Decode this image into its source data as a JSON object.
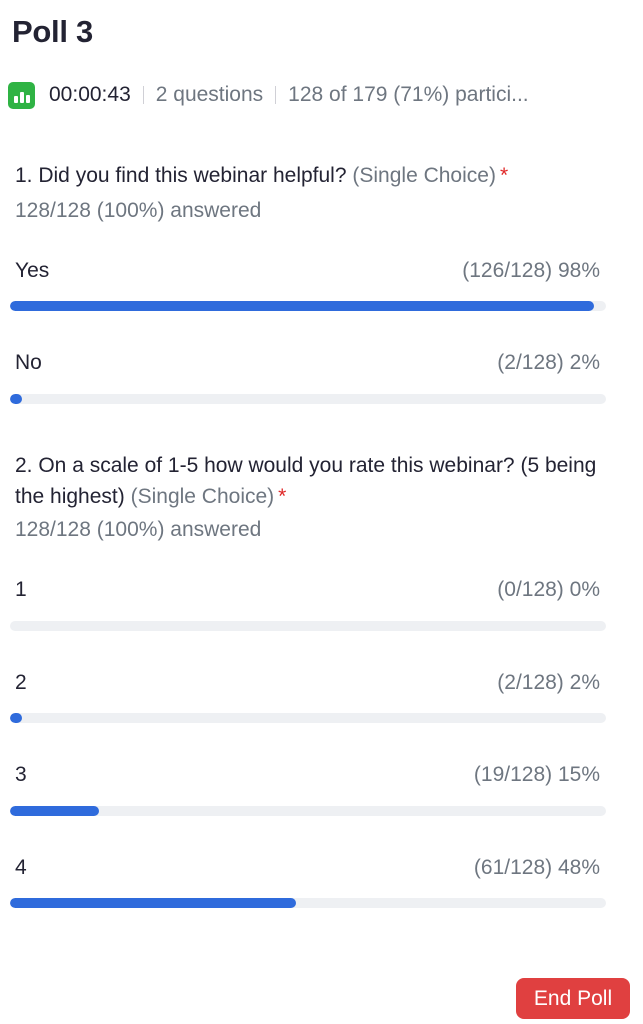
{
  "poll": {
    "title": "Poll 3",
    "timer": "00:00:43",
    "question_count": "2 questions",
    "participants": "128 of 179 (71%) partici..."
  },
  "icons": {
    "poll": "bar-chart-icon"
  },
  "colors": {
    "accent": "#2f6bdc",
    "danger": "#e04040",
    "poll_icon": "#2fb344",
    "required": "#e02828"
  },
  "questions": [
    {
      "text": "1. Did you find this webinar helpful?",
      "type": "(Single Choice)",
      "required": "*",
      "answered": "128/128 (100%) answered",
      "options": [
        {
          "label": "Yes",
          "stat": "(126/128) 98%",
          "percent": 98
        },
        {
          "label": "No",
          "stat": "(2/128) 2%",
          "percent": 2
        }
      ]
    },
    {
      "text": "2. On a scale of 1-5 how would you rate this webinar? (5 being the highest)",
      "type": "(Single Choice)",
      "required": "*",
      "answered": "128/128 (100%) answered",
      "options": [
        {
          "label": "1",
          "stat": "(0/128) 0%",
          "percent": 0
        },
        {
          "label": "2",
          "stat": "(2/128) 2%",
          "percent": 2
        },
        {
          "label": "3",
          "stat": "(19/128) 15%",
          "percent": 15
        },
        {
          "label": "4",
          "stat": "(61/128) 48%",
          "percent": 48
        }
      ]
    }
  ],
  "actions": {
    "end_poll": "End Poll"
  }
}
